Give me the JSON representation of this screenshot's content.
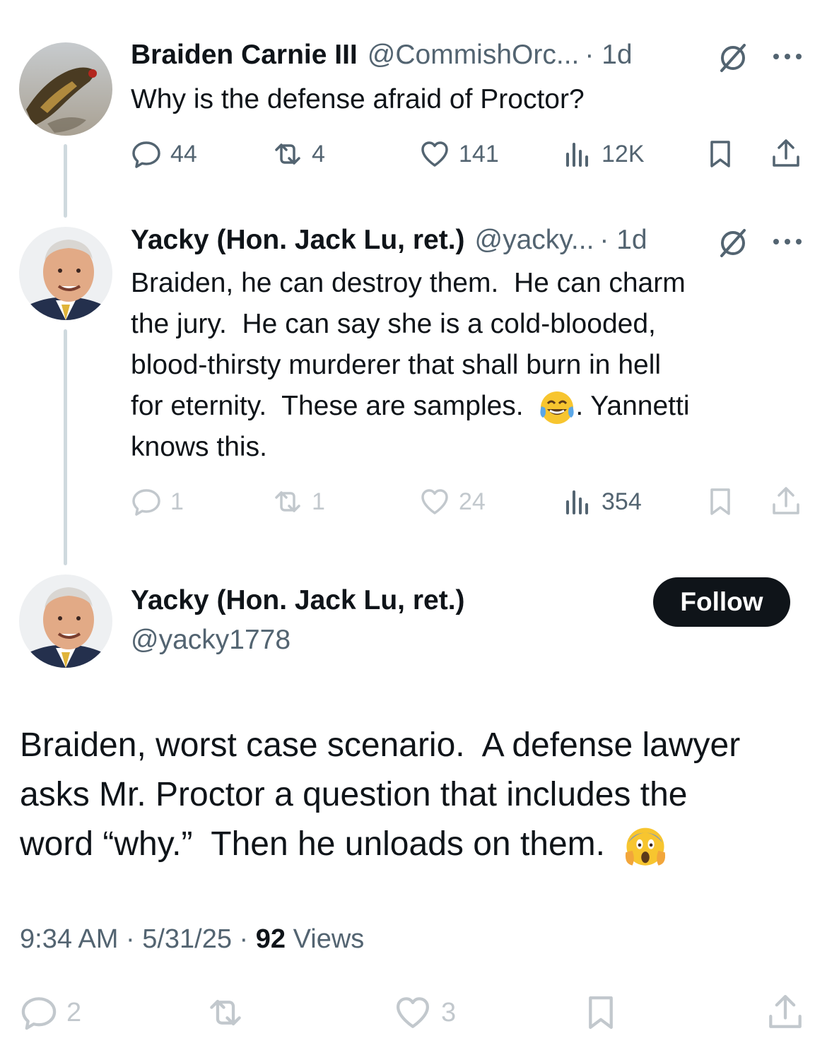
{
  "tweet1": {
    "name": "Braiden Carnie III",
    "handle": "@CommishOrc...",
    "time": "· 1d",
    "text": "Why is the defense afraid of Proctor?",
    "replies": "44",
    "reposts": "4",
    "likes": "141",
    "views": "12K"
  },
  "tweet2": {
    "name": "Yacky (Hon. Jack Lu, ret.)",
    "handle": "@yacky...",
    "time": "· 1d",
    "text_a": "Braiden, he can destroy them.  He can charm\nthe jury.  He can say she is a cold-blooded,\nblood-thirsty murderer that shall burn in hell\nfor eternity.  These are samples.  ",
    "emoji_a": "face-with-tears-of-joy",
    "text_b": ". Yannetti\nknows this.",
    "replies": "1",
    "reposts": "1",
    "likes": "24",
    "views": "354"
  },
  "main": {
    "name": "Yacky (Hon. Jack Lu, ret.)",
    "handle": "@yacky1778",
    "follow_label": "Follow",
    "text": "Braiden, worst case scenario.  A defense lawyer\nasks Mr. Proctor a question that includes the\nword “why.”  Then he unloads on them.  ",
    "emoji": "face-screaming-in-fear",
    "timestamp": "9:34 AM · 5/31/25 · ",
    "views_count": "92",
    "views_label": " Views",
    "replies": "2",
    "likes": "3"
  },
  "colors": {
    "text": "#0f1419",
    "secondary": "#536471",
    "thread_line": "#cfd9de",
    "button": "#0f1419"
  }
}
